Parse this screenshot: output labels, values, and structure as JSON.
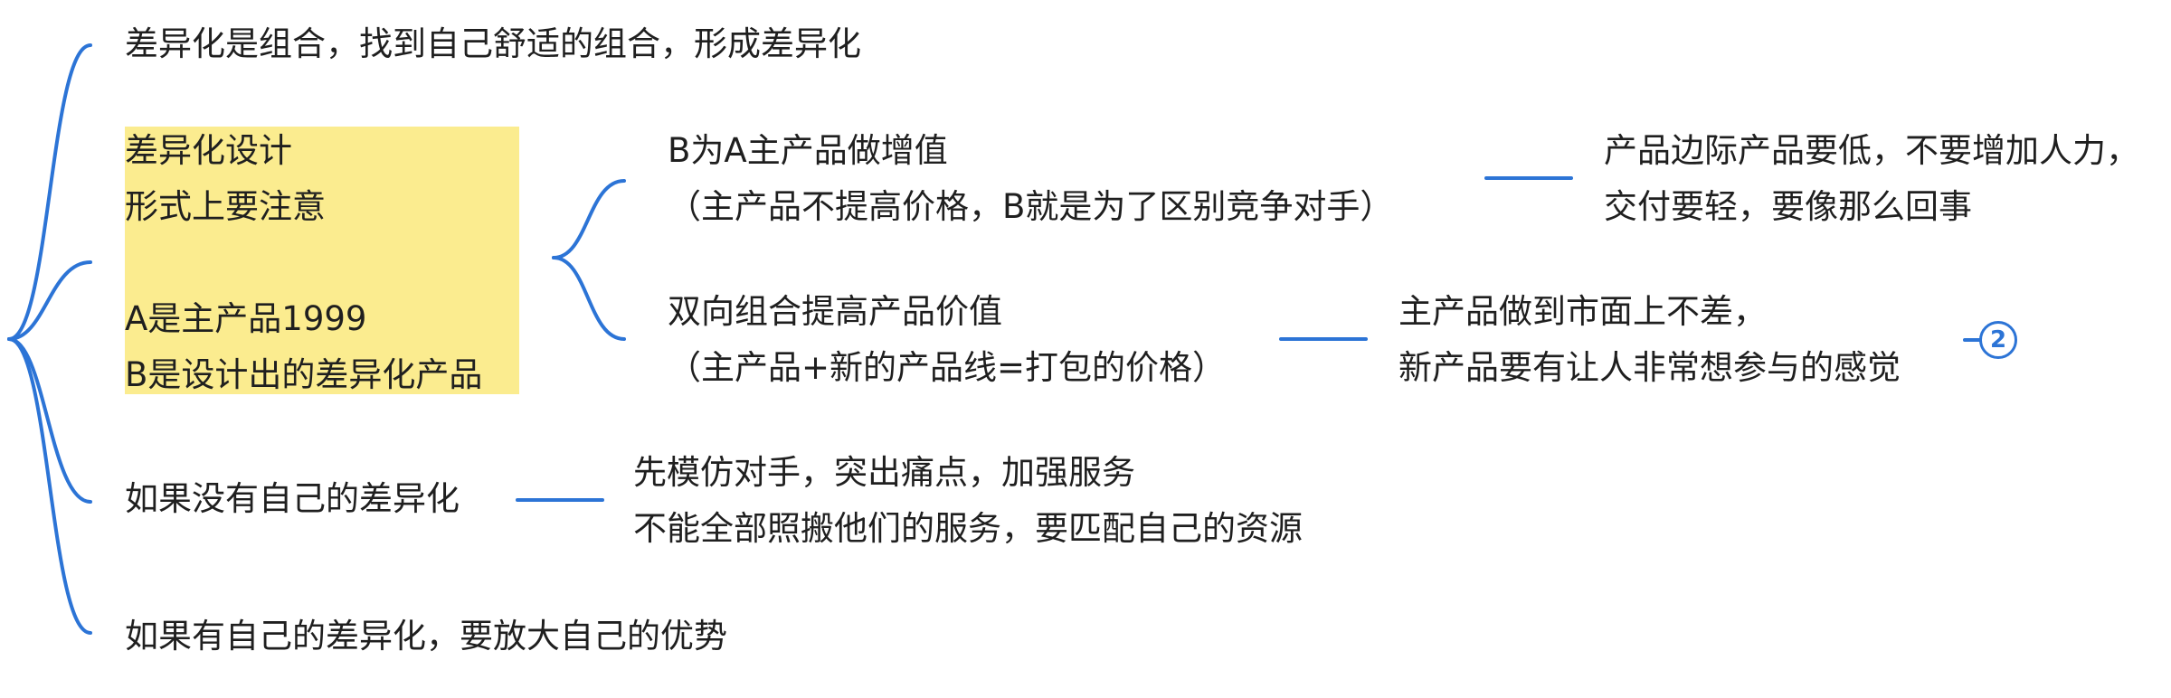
{
  "mindmap": {
    "node_differentiation": "差异化是组合，找到自己舒适的组合，形成差异化",
    "node_design": {
      "lines": [
        "差异化设计",
        "形式上要注意",
        "",
        "A是主产品1999",
        "B是设计出的差异化产品"
      ]
    },
    "node_b_value": {
      "lines": [
        "B为A主产品做增值",
        "（主产品不提高价格，B就是为了区别竞争对手）"
      ]
    },
    "node_marginal": {
      "lines": [
        "产品边际产品要低，不要增加人力，",
        "交付要轻，要像那么回事"
      ]
    },
    "node_bundle": {
      "lines": [
        "双向组合提高产品价值",
        "（主产品+新的产品线=打包的价格）"
      ]
    },
    "node_quality": {
      "lines": [
        "主产品做到市面上不差，",
        "新产品要有让人非常想参与的感觉"
      ]
    },
    "collapsed_badge": "2",
    "node_no_diff": "如果没有自己的差异化",
    "node_imitate": {
      "lines": [
        "先模仿对手，突出痛点，加强服务",
        "不能全部照搬他们的服务，要匹配自己的资源"
      ]
    },
    "node_have_diff": "如果有自己的差异化，要放大自己的优势"
  },
  "colors": {
    "connector": "#2c74d6",
    "highlight": "#fbec8f",
    "text": "#1f1f1f"
  }
}
